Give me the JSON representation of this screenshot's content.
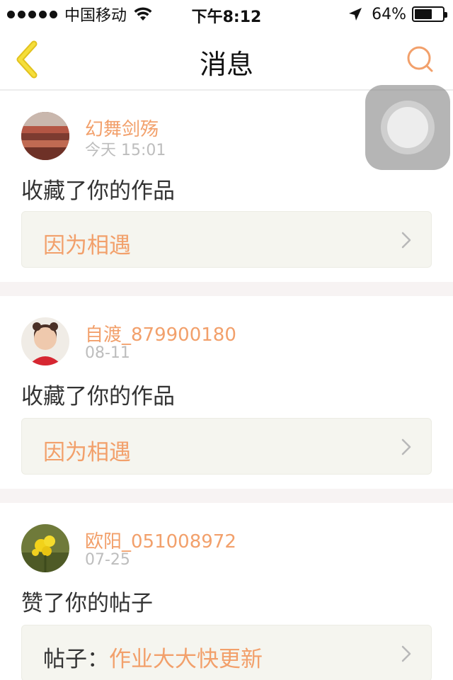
{
  "status_bar": {
    "carrier": "中国移动",
    "time": "下午8:12",
    "battery_pct": "64%",
    "battery_level": 0.64,
    "icons": [
      "signal-dots-icon",
      "wifi-icon",
      "location-arrow-icon",
      "battery-icon"
    ]
  },
  "nav": {
    "title": "消息",
    "back_icon": "chevron-left-icon",
    "search_icon": "search-icon"
  },
  "messages": [
    {
      "username": "幻舞剑殇",
      "time": "今天 15:01",
      "action": "收藏了你的作品",
      "ref_prefix": "",
      "ref_title": "因为相遇"
    },
    {
      "username": "自渡_879900180",
      "time": "08-11",
      "action": "收藏了你的作品",
      "ref_prefix": "",
      "ref_title": "因为相遇"
    },
    {
      "username": "欧阳_051008972",
      "time": "07-25",
      "action": "赞了你的帖子",
      "ref_prefix": "帖子：",
      "ref_title": "作业大大快更新"
    }
  ],
  "colors": {
    "accent": "#f2a06b",
    "back_arrow": "#f2d12c",
    "separator": "#f7f3f3",
    "ref_bg": "#f5f5ef"
  }
}
